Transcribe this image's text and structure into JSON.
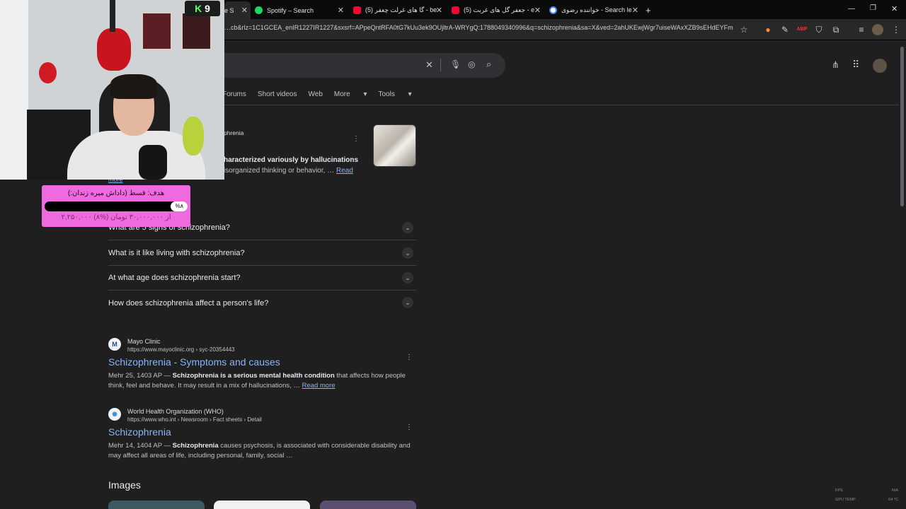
{
  "browser": {
    "tabs": [
      {
        "label": "e S",
        "active": true
      },
      {
        "label": "Spotify – Search",
        "icon": "spotify-icon",
        "color": "#1ed760"
      },
      {
        "label": "(5) گا های غرلت چعفر - be",
        "icon": "youtube-icon",
        "color": "#ff0033"
      },
      {
        "label": "(5) جعفر گل های غربت - e",
        "icon": "youtube-icon",
        "color": "#ff0033"
      },
      {
        "label": "خواننده رضوی - Search le",
        "icon": "google-icon",
        "color": "#ffffff"
      }
    ],
    "new_tab": "+",
    "url": "…cb&rlz=1C1GCEA_enIR1227IR1227&sxsrf=APpeQntRFA0tG7kUu3ek9OUjltrA-WRYgQ:1788049340996&q=schizophrenia&sa=X&ved=2ahUKEwjWgr7uiseWAxXZB9sEHdEYFm…"
  },
  "search": {
    "filters": [
      "Forums",
      "Short videos",
      "Web",
      "More",
      "Tools"
    ]
  },
  "knowledge": {
    "source": "phrenia",
    "snippet_bold": "haracterized variously by hallucinations",
    "snippet": "isorganized thinking or behavior, … ",
    "read": "Read",
    "more": "more"
  },
  "questions": [
    "What are 5 signs of schizophrenia?",
    "What is it like living with schizophrenia?",
    "At what age does schizophrenia start?",
    "How does schizophrenia affect a person's life?"
  ],
  "results": [
    {
      "source": "Mayo Clinic",
      "url": "https://www.mayoclinic.org › syc-20354443",
      "title": "Schizophrenia - Symptoms and causes",
      "date": "Mehr 25, 1403 AP — ",
      "bold": "Schizophrenia is a serious mental health condition",
      "text": " that affects how people think, feel and behave. It may result in a mix of hallucinations, … ",
      "more": "Read more"
    },
    {
      "source": "World Health Organization (WHO)",
      "url": "https://www.who.int › Newsroom › Fact sheets › Detail",
      "title": "Schizophrenia",
      "date": "Mehr 14, 1404 AP — ",
      "bold": "Schizophrenia",
      "text": " causes psychosis, is associated with considerable disability and may affect all areas of life, including personal, family, social …",
      "more": ""
    }
  ],
  "images_heading": "Images",
  "overlay": {
    "badge": "9",
    "donate_title": "هدف: قسط (داداش میره زندان:)",
    "donate_pct": "%۸",
    "donate_progress": 0.08,
    "donate_amount": "۲,۲۵۰,۰۰۰ از ۳۰,۰۰۰,۰۰۰ تومان (%۸)"
  },
  "osd": {
    "fps_label": "FPS",
    "fps_value": "N/A",
    "gpu_label": "GPU TEMP",
    "gpu_value": "64 °C"
  }
}
